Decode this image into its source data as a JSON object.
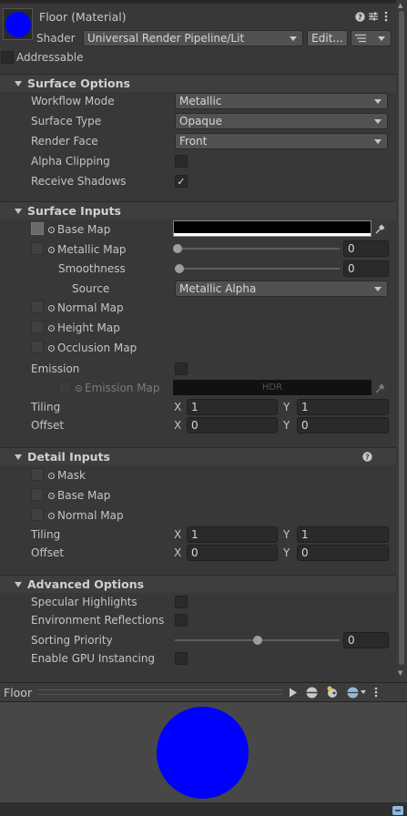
{
  "header": {
    "material_name": "Floor (Material)",
    "shader_label": "Shader",
    "shader_value": "Universal Render Pipeline/Lit",
    "edit_label": "Edit...",
    "addressable_label": "Addressable",
    "preview_color": "#0000ff"
  },
  "surface_options": {
    "title": "Surface Options",
    "workflow_mode": {
      "label": "Workflow Mode",
      "value": "Metallic"
    },
    "surface_type": {
      "label": "Surface Type",
      "value": "Opaque"
    },
    "render_face": {
      "label": "Render Face",
      "value": "Front"
    },
    "alpha_clipping": {
      "label": "Alpha Clipping",
      "checked": false
    },
    "receive_shadows": {
      "label": "Receive Shadows",
      "checked": true,
      "check_mark": "✓"
    }
  },
  "surface_inputs": {
    "title": "Surface Inputs",
    "base_map": "Base Map",
    "metallic_map": {
      "label": "Metallic Map",
      "value": "0",
      "fraction": 0
    },
    "smoothness": {
      "label": "Smoothness",
      "value": "0",
      "fraction": 0
    },
    "source": {
      "label": "Source",
      "value": "Metallic Alpha"
    },
    "normal_map": "Normal Map",
    "height_map": "Height Map",
    "occlusion_map": "Occlusion Map",
    "emission": {
      "label": "Emission",
      "checked": false
    },
    "emission_map": {
      "label": "Emission Map",
      "hdr": "HDR"
    },
    "tiling": {
      "label": "Tiling",
      "x_axis": "X",
      "y_axis": "Y",
      "x": "1",
      "y": "1"
    },
    "offset": {
      "label": "Offset",
      "x_axis": "X",
      "y_axis": "Y",
      "x": "0",
      "y": "0"
    }
  },
  "detail_inputs": {
    "title": "Detail Inputs",
    "mask": "Mask",
    "base_map": "Base Map",
    "normal_map": "Normal Map",
    "tiling": {
      "label": "Tiling",
      "x_axis": "X",
      "y_axis": "Y",
      "x": "1",
      "y": "1"
    },
    "offset": {
      "label": "Offset",
      "x_axis": "X",
      "y_axis": "Y",
      "x": "0",
      "y": "0"
    }
  },
  "advanced_options": {
    "title": "Advanced Options",
    "specular_highlights": {
      "label": "Specular Highlights",
      "checked": false
    },
    "environment_reflections": {
      "label": "Environment Reflections",
      "checked": false
    },
    "sorting_priority": {
      "label": "Sorting Priority",
      "value": "0",
      "fraction": 0.5
    },
    "gpu_instancing": {
      "label": "Enable GPU Instancing",
      "checked": false
    }
  },
  "preview": {
    "title": "Floor",
    "sphere_color": "#0000ff"
  },
  "icons": {
    "help": "help-icon",
    "presets": "presets-icon",
    "more": "kebab-menu-icon",
    "list": "list-icon",
    "eyedropper": "eyedropper-icon",
    "play": "play-icon",
    "sphere": "sphere-preview-icon",
    "light": "light-icon",
    "globe": "globe-icon"
  }
}
